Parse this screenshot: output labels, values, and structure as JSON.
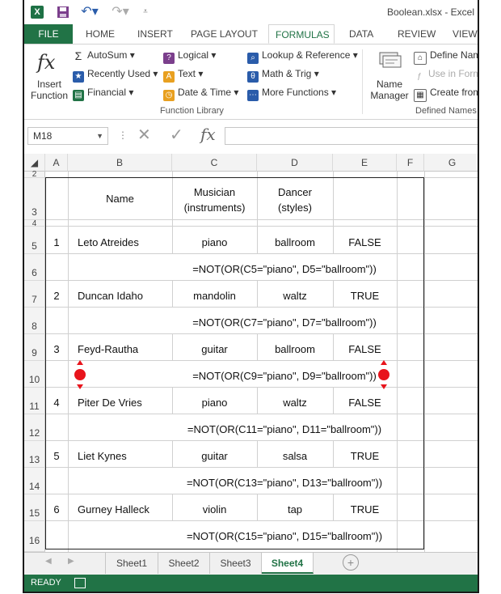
{
  "titlebar": {
    "app_icon_label": "X",
    "doc_title": "Boolean.xlsx - Excel"
  },
  "tabs": [
    "FILE",
    "HOME",
    "INSERT",
    "PAGE LAYOUT",
    "FORMULAS",
    "DATA",
    "REVIEW",
    "VIEW"
  ],
  "active_tab": "FORMULAS",
  "ribbon": {
    "insert_function": [
      "Insert",
      "Function"
    ],
    "autosum": "AutoSum",
    "recently_used": "Recently Used",
    "financial": "Financial",
    "logical": "Logical",
    "text": "Text",
    "date_time": "Date & Time",
    "lookup_reference": "Lookup & Reference",
    "math_trig": "Math & Trig",
    "more_functions": "More Functions",
    "group_function_library": "Function Library",
    "name_manager": [
      "Name",
      "Manager"
    ],
    "define_name": "Define Name",
    "use_in_formula": "Use in Formula",
    "create_from": "Create from Selection",
    "group_defined_names": "Defined Names"
  },
  "formula_bar": {
    "name_box": "M18",
    "fx_label": "fx",
    "value": ""
  },
  "columns": [
    "A",
    "B",
    "C",
    "D",
    "E",
    "F",
    "G"
  ],
  "rows": [
    "2",
    "3",
    "4",
    "5",
    "6",
    "7",
    "8",
    "9",
    "10",
    "11",
    "12",
    "13",
    "14",
    "15",
    "16"
  ],
  "header": {
    "name": "Name",
    "musician": [
      "Musician",
      "(instruments)"
    ],
    "dancer": [
      "Dancer",
      "(styles)"
    ]
  },
  "records": [
    {
      "num": "1",
      "name": "Leto Atreides",
      "musician": "piano",
      "dancer": "ballroom",
      "result": "FALSE",
      "formula": "=NOT(OR(C5=\"piano\", D5=\"ballroom\"))"
    },
    {
      "num": "2",
      "name": "Duncan Idaho",
      "musician": "mandolin",
      "dancer": "waltz",
      "result": "TRUE",
      "formula": "=NOT(OR(C7=\"piano\", D7=\"ballroom\"))"
    },
    {
      "num": "3",
      "name": "Feyd-Rautha",
      "musician": "guitar",
      "dancer": "ballroom",
      "result": "FALSE",
      "formula": "=NOT(OR(C9=\"piano\", D9=\"ballroom\"))"
    },
    {
      "num": "4",
      "name": "Piter De Vries",
      "musician": "piano",
      "dancer": "waltz",
      "result": "FALSE",
      "formula": "=NOT(OR(C11=\"piano\", D11=\"ballroom\"))"
    },
    {
      "num": "5",
      "name": "Liet Kynes",
      "musician": "guitar",
      "dancer": "salsa",
      "result": "TRUE",
      "formula": "=NOT(OR(C13=\"piano\", D13=\"ballroom\"))"
    },
    {
      "num": "6",
      "name": "Gurney Halleck",
      "musician": "violin",
      "dancer": "tap",
      "result": "TRUE",
      "formula": "=NOT(OR(C15=\"piano\", D15=\"ballroom\"))"
    }
  ],
  "sheets": [
    "Sheet1",
    "Sheet2",
    "Sheet3",
    "Sheet4"
  ],
  "active_sheet": "Sheet4",
  "status": "READY",
  "colors": {
    "excel_green": "#217346",
    "marker_red": "#e8141c"
  }
}
